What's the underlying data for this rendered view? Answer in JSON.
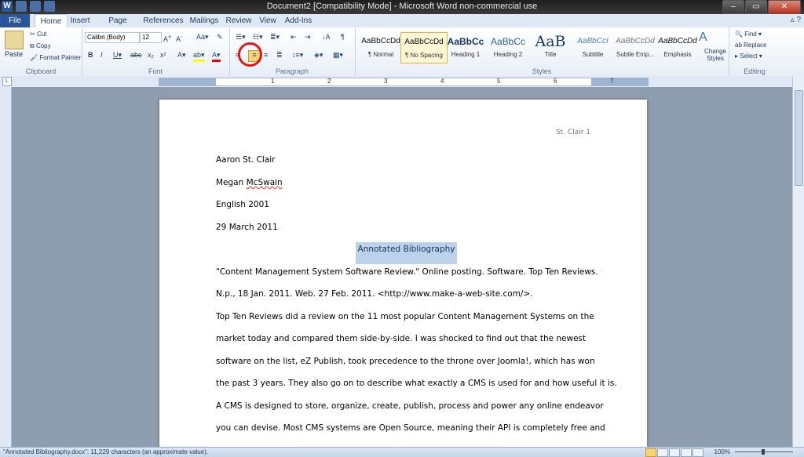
{
  "window": {
    "title": "Document2 [Compatibility Mode] - Microsoft Word non-commercial use"
  },
  "tabs": [
    "File",
    "Home",
    "Insert",
    "Page Layout",
    "References",
    "Mailings",
    "Review",
    "View",
    "Add-Ins"
  ],
  "clipboard": {
    "paste": "Paste",
    "cut": "Cut",
    "copy": "Copy",
    "format_painter": "Format Painter",
    "label": "Clipboard"
  },
  "font": {
    "name": "Calibri (Body)",
    "size": "12",
    "label": "Font"
  },
  "paragraph": {
    "label": "Paragraph"
  },
  "styles": {
    "label": "Styles",
    "items": [
      {
        "sample": "AaBbCcDd",
        "name": "¶ Normal"
      },
      {
        "sample": "AaBbCcDd",
        "name": "¶ No Spacing"
      },
      {
        "sample": "AaBbCc",
        "name": "Heading 1"
      },
      {
        "sample": "AaBbCc",
        "name": "Heading 2"
      },
      {
        "sample": "AaB",
        "name": "Title"
      },
      {
        "sample": "AaBbCcI",
        "name": "Subtitle"
      },
      {
        "sample": "AaBbCcDd",
        "name": "Subtle Emp..."
      },
      {
        "sample": "AaBbCcDd",
        "name": "Emphasis"
      }
    ],
    "change": "Change Styles"
  },
  "editing": {
    "find": "Find",
    "replace": "Replace",
    "select": "Select",
    "label": "Editing"
  },
  "ruler_numbers": [
    "1",
    "2",
    "3",
    "4",
    "5",
    "6",
    "7"
  ],
  "document": {
    "header": "St. Clair 1",
    "lines": [
      "Aaron St. Clair",
      "Megan McSwain",
      "English 2001",
      "29 March 2011"
    ],
    "title": "Annotated Bibliography",
    "body": [
      "\"Content Management System Software Review.\" Online posting. Software. Top Ten Reviews.",
      "N.p., 18 Jan. 2011. Web. 27 Feb. 2011. <http://www.make-a-web-site.com/>.",
      "Top Ten Reviews did a review on the 11 most popular Content Management Systems on the",
      "market today and compared them side-by-side. I was shocked to find out that the newest",
      "software on the list, eZ Publish, took precedence to the throne over Joomla!, which has won",
      "the past 3 years.  They also go on to describe what exactly a CMS is used for and how useful it is.",
      "A CMS is designed to store, organize, create, publish, process and power any online endeavor",
      "you can devise. Most CMS systems are Open Source, meaning their API is completely free and"
    ]
  },
  "status": {
    "text": "\"Annotated Bibliography.docx\": 11,229 characters (an approximate value).",
    "zoom": "100%"
  }
}
